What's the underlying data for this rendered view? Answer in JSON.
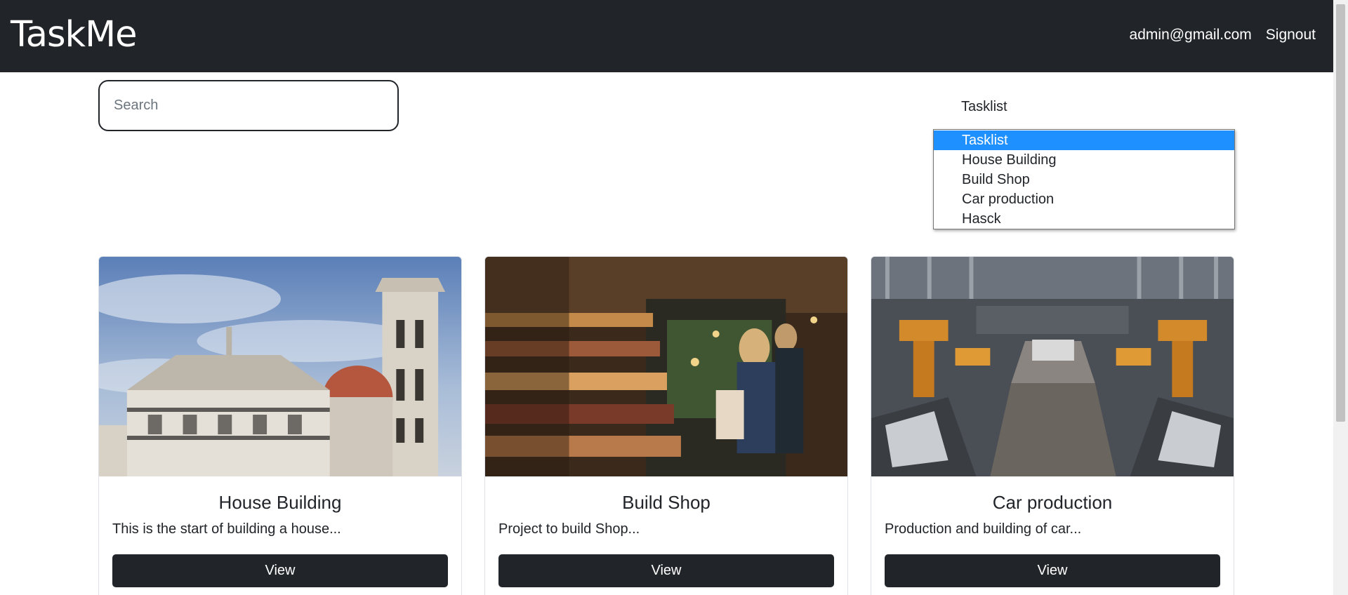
{
  "navbar": {
    "brand": "TaskMe",
    "user_email": "admin@gmail.com",
    "signout_label": "Signout"
  },
  "search": {
    "placeholder": "Search",
    "value": ""
  },
  "tasklist_select": {
    "selected": "Tasklist",
    "options": [
      "Tasklist",
      "House Building",
      "Build Shop",
      "Car production",
      "Hasck"
    ]
  },
  "cards": [
    {
      "title": "House Building",
      "text": "This is the start of building a house...",
      "button_label": "View",
      "image": "florence-cathedral-photo"
    },
    {
      "title": "Build Shop",
      "text": "Project to build Shop...",
      "button_label": "View",
      "image": "shop-interior-photo"
    },
    {
      "title": "Car production",
      "text": "Production and building of car...",
      "button_label": "View",
      "image": "car-factory-photo"
    }
  ],
  "colors": {
    "navbar_bg": "#212529",
    "selected_option_bg": "#1e90ff",
    "button_bg": "#212529"
  }
}
